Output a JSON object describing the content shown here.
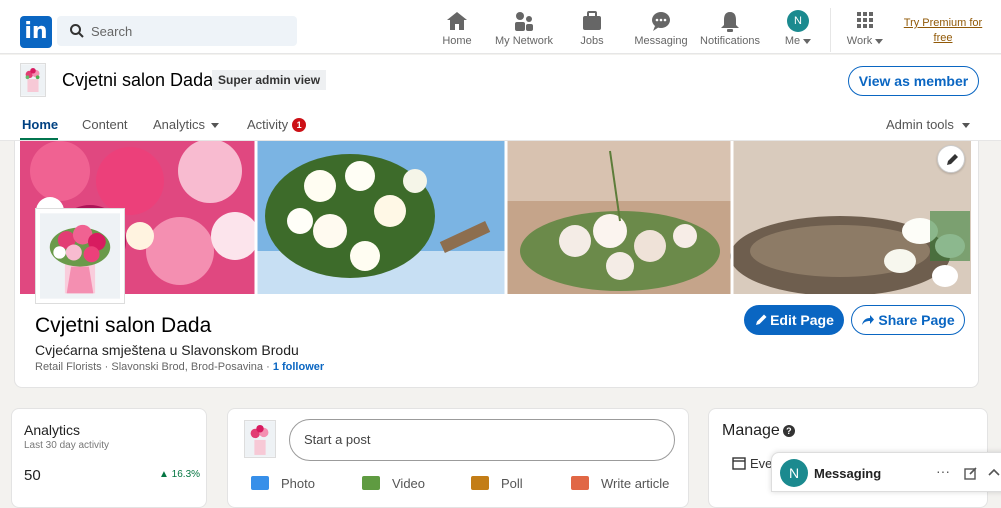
{
  "topbar": {
    "logo": "in",
    "search_placeholder": "Search",
    "nav": [
      {
        "label": "Home",
        "icon": "home-icon"
      },
      {
        "label": "My Network",
        "icon": "network-icon"
      },
      {
        "label": "Jobs",
        "icon": "briefcase-icon"
      },
      {
        "label": "Messaging",
        "icon": "messaging-icon"
      },
      {
        "label": "Notifications",
        "icon": "bell-icon"
      },
      {
        "label": "Me",
        "icon": "avatar-icon",
        "avatar_letter": "N"
      },
      {
        "label": "Work",
        "icon": "grid-icon"
      }
    ],
    "premium": "Try Premium for free"
  },
  "page_header": {
    "name": "Cvjetni salon Dada",
    "admin_badge": "Super admin view",
    "view_as_member": "View as member",
    "tabs": [
      "Home",
      "Content",
      "Analytics",
      "Activity"
    ],
    "activity_count": "1",
    "admin_tools": "Admin tools"
  },
  "profile": {
    "name": "Cvjetni salon Dada",
    "tagline": "Cvjećarna smještena u Slavonskom Brodu",
    "meta": "Retail Florists · Slavonski Brod, Brod-Posavina · ",
    "followers": "1 follower",
    "edit_page": "Edit Page",
    "share_page": "Share Page"
  },
  "analytics": {
    "title": "Analytics",
    "subtitle": "Last 30 day activity",
    "value": "50",
    "change": "▲ 16.3%"
  },
  "post": {
    "placeholder": "Start a post",
    "actions": [
      "Photo",
      "Video",
      "Poll",
      "Write article"
    ]
  },
  "manage": {
    "title": "Manage",
    "item": "Eve"
  },
  "messaging": {
    "avatar_letter": "N",
    "label": "Messaging",
    "dots": "···"
  },
  "colors": {
    "linkedin_blue": "#0a66c2",
    "active_tab_underline": "#01754f",
    "badge_red": "#cc1016",
    "premium_gold": "#915907"
  }
}
